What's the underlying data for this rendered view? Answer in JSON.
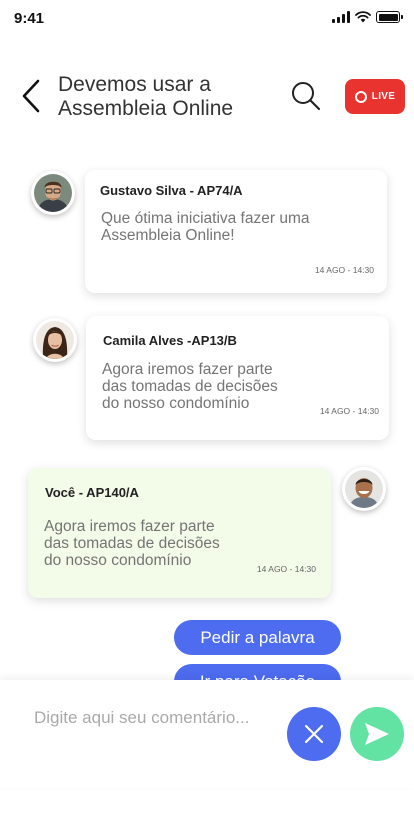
{
  "status_bar": {
    "time": "9:41"
  },
  "header": {
    "title": "Devemos usar a Assembleia Online",
    "live_label": "LIVE"
  },
  "colors": {
    "live": "#e8332f",
    "primary": "#4d6cf0",
    "send": "#62e3a4",
    "mine_bubble": "#f3fbe9"
  },
  "messages": [
    {
      "author": "Gustavo Silva  - AP74/A",
      "text": "Que ótima iniciativa fazer uma Assembleia Online!",
      "time": "14 AGO - 14:30",
      "avatar": "man-glasses-avatar"
    },
    {
      "author": "Camila Alves -AP13/B",
      "text": "Agora iremos fazer parte das tomadas de decisões do nosso condomínio",
      "time": "14 AGO - 14:30",
      "avatar": "woman-avatar"
    },
    {
      "author": "Você - AP140/A",
      "text": "Agora iremos fazer parte das tomadas de decisões do nosso condomínio",
      "time": "14 AGO - 14:30",
      "avatar": "man-smiling-avatar"
    }
  ],
  "actions": {
    "request_floor": "Pedir a palavra",
    "go_to_vote": "Ir para Votação"
  },
  "composer": {
    "placeholder": "Digite aqui seu comentário..."
  }
}
